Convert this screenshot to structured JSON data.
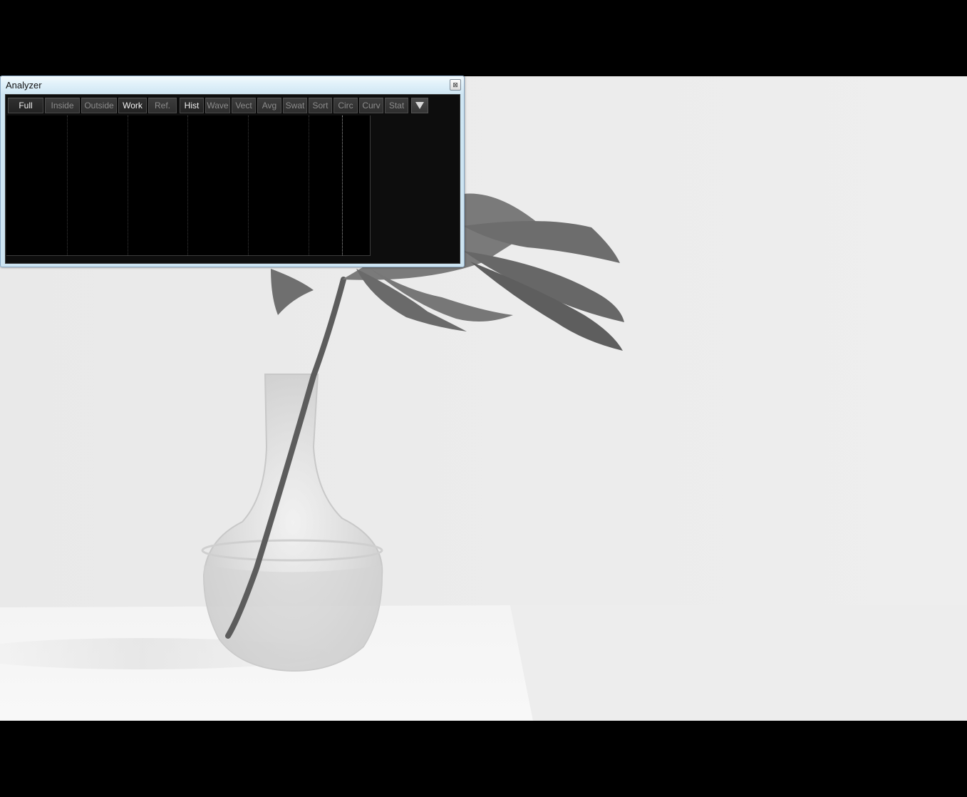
{
  "window": {
    "title": "Analyzer",
    "close_glyph": "⊠"
  },
  "toolbar": {
    "buttons": [
      {
        "label": "Full",
        "active": true
      },
      {
        "label": "Inside",
        "active": false
      },
      {
        "label": "Outside",
        "active": false
      },
      {
        "label": "Work",
        "active": true
      },
      {
        "label": "Ref.",
        "active": false
      },
      {
        "label": "Hist",
        "active": true
      },
      {
        "label": "Wave",
        "active": false
      },
      {
        "label": "Vect",
        "active": false
      },
      {
        "label": "Avg",
        "active": false
      },
      {
        "label": "Swat",
        "active": false
      },
      {
        "label": "Sort",
        "active": false
      },
      {
        "label": "Circ",
        "active": false
      },
      {
        "label": "Curv",
        "active": false
      },
      {
        "label": "Stat",
        "active": false
      }
    ],
    "dropdown_icon": "triangle-down-icon"
  },
  "colors": {
    "panel_bg": "#0d0d0d",
    "plot_bg": "#000000",
    "photo_bg": "#ececec",
    "window_frame": "#cde4f1"
  }
}
